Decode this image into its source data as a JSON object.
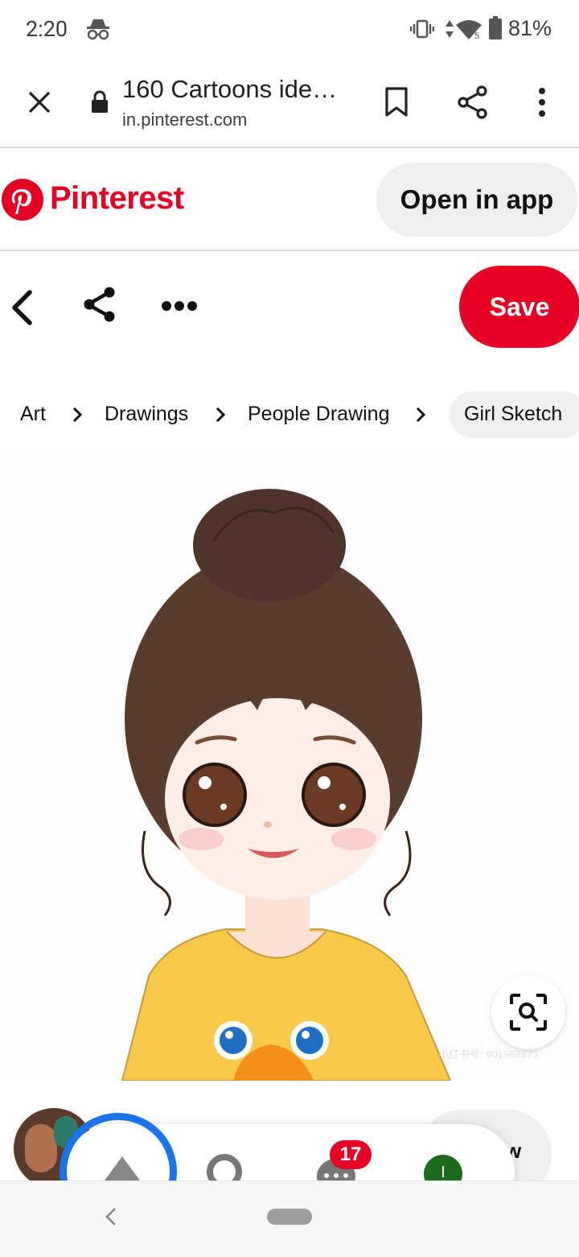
{
  "status_bar": {
    "time": "2:20",
    "battery_percent": "81%",
    "icons": [
      "incognito-icon",
      "vibrate-icon",
      "data-arrows-icon",
      "wifi-icon",
      "battery-icon"
    ]
  },
  "browser": {
    "page_title": "160 Cartoons ide…",
    "url": "in.pinterest.com",
    "icons": [
      "close-icon",
      "lock-icon",
      "bookmark-icon",
      "share-icon",
      "more-vert-icon"
    ]
  },
  "pinterest_header": {
    "brand": "Pinterest",
    "open_in_app_label": "Open in app"
  },
  "pin_actions": {
    "save_label": "Save",
    "icons": [
      "back-chevron-icon",
      "share-icon",
      "more-horiz-icon"
    ]
  },
  "breadcrumbs": [
    "Art",
    "Drawings",
    "People Drawing",
    "Girl Sketch"
  ],
  "image": {
    "watermark": "小红书号: 901988873"
  },
  "bottom_bar": {
    "notification_count": "17",
    "follow_label_partial": "w"
  },
  "colors": {
    "brand_red": "#e60023",
    "chip_grey": "#efefef",
    "text": "#111111"
  }
}
